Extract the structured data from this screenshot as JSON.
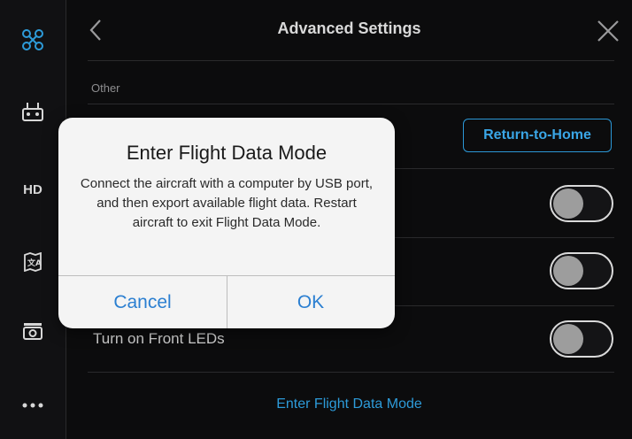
{
  "sidebar": {
    "items": [
      {
        "icon": "drone-icon",
        "label": ""
      },
      {
        "icon": "remote-controller-icon",
        "label": ""
      },
      {
        "icon": "hd-icon",
        "label": "HD"
      },
      {
        "icon": "map-icon",
        "label": ""
      },
      {
        "icon": "camera-icon",
        "label": ""
      },
      {
        "icon": "more-icon",
        "label": "..."
      }
    ]
  },
  "header": {
    "title": "Advanced Settings",
    "back_icon": "chevron-left-icon",
    "close_icon": "close-icon"
  },
  "section": {
    "label": "Other"
  },
  "buttons": {
    "return_to_home": "Return-to-Home"
  },
  "toggles": [
    {
      "label": "",
      "state": "off"
    },
    {
      "label": "",
      "state": "off"
    },
    {
      "label": "Turn on Front LEDs",
      "state": "off"
    }
  ],
  "link": {
    "flight_data_mode": "Enter Flight Data Mode"
  },
  "dialog": {
    "title": "Enter Flight Data Mode",
    "message": "Connect the aircraft with a computer by USB port, and then export available flight data. Restart aircraft to exit Flight Data Mode.",
    "cancel_label": "Cancel",
    "ok_label": "OK"
  },
  "colors": {
    "accent": "#2d9bd9",
    "dialog_button": "#2b7fd1",
    "background": "#0c0c0d"
  }
}
